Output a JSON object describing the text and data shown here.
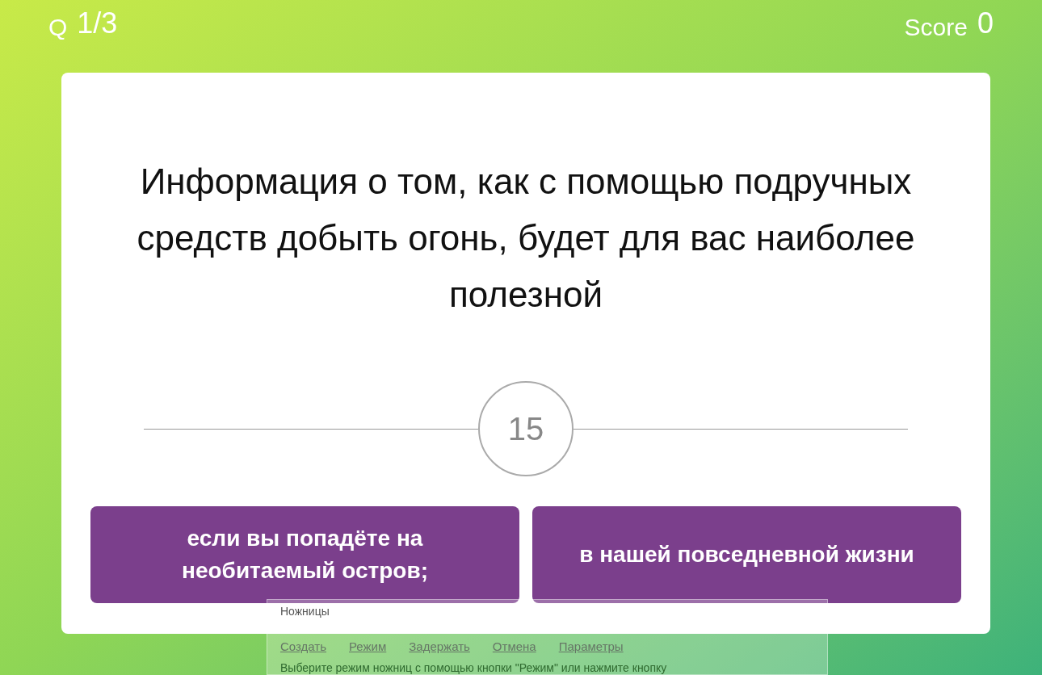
{
  "header": {
    "question_label": "Q",
    "question_count": "1/3",
    "score_label": "Score",
    "score": "0"
  },
  "question": "Информация о том, как с помощью подручных средств добыть огонь, будет для вас наиболее полезной",
  "timer": "15",
  "answers": [
    "если вы попадёте на необитаемый остров;",
    "в нашей повседневной жизни"
  ],
  "overlay_window": {
    "title": "Ножницы",
    "toolbar": [
      "Создать",
      "Режим",
      "Задержать",
      "Отмена",
      "Параметры"
    ],
    "hint": "Выберите режим ножниц с помощью кнопки \"Режим\" или нажмите кнопку"
  }
}
